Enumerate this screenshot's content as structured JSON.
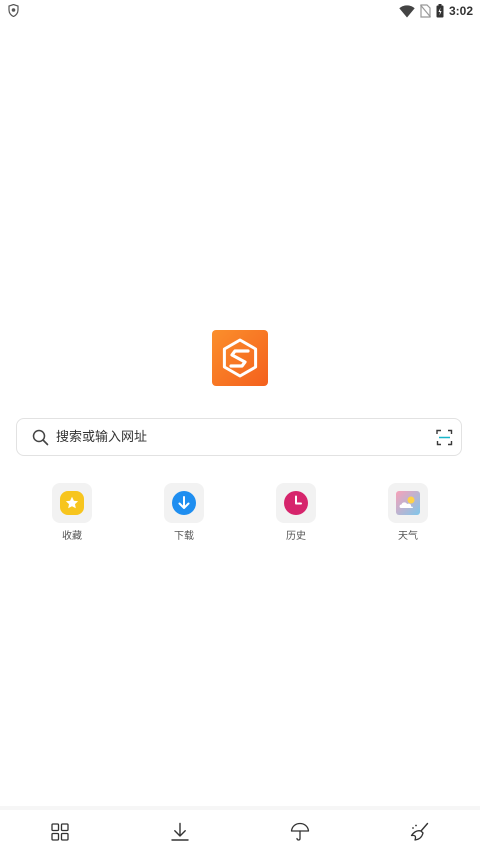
{
  "status_bar": {
    "time": "3:02",
    "icons": [
      "shield-icon",
      "wifi-icon",
      "no-sim-icon",
      "battery-icon"
    ]
  },
  "logo": {
    "icon": "browser-logo-icon",
    "color_start": "#fb8f2c",
    "color_end": "#f4601d"
  },
  "search": {
    "placeholder": "搜索或输入网址",
    "value": "",
    "icon": "search-icon",
    "scan_icon": "scan-icon"
  },
  "shortcuts": [
    {
      "label": "收藏",
      "icon": "star-icon",
      "color": "#f7c51e"
    },
    {
      "label": "下载",
      "icon": "download-icon",
      "color": "#1f8ef0"
    },
    {
      "label": "历史",
      "icon": "clock-icon",
      "color": "#d6256c"
    },
    {
      "label": "天气",
      "icon": "weather-icon",
      "color": "#f0a3b5"
    }
  ],
  "bottom_nav": {
    "items": [
      {
        "icon": "grid-icon"
      },
      {
        "icon": "download-icon"
      },
      {
        "icon": "umbrella-icon"
      },
      {
        "icon": "broom-icon"
      }
    ]
  }
}
